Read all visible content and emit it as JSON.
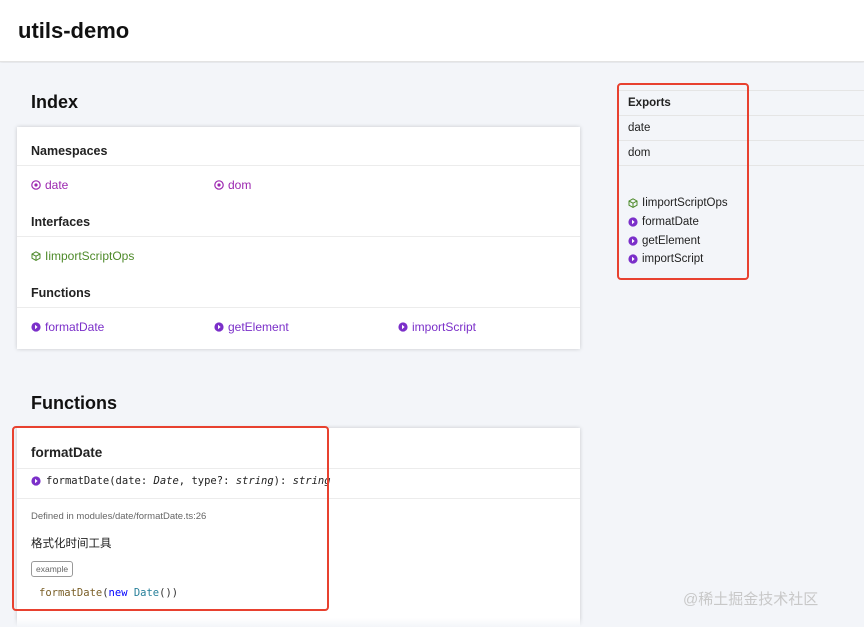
{
  "header": {
    "title": "utils-demo"
  },
  "index": {
    "heading": "Index",
    "namespaces": {
      "label": "Namespaces",
      "items": [
        "date",
        "dom"
      ]
    },
    "interfaces": {
      "label": "Interfaces",
      "items": [
        "IimportScriptOps"
      ]
    },
    "functions": {
      "label": "Functions",
      "items": [
        "formatDate",
        "getElement",
        "importScript"
      ]
    }
  },
  "functions_section": {
    "heading": "Functions",
    "entry": {
      "name": "formatDate",
      "signature": {
        "name": "formatDate",
        "open": "(",
        "p1": "date",
        "colon1": ": ",
        "t1": "Date",
        "comma": ", ",
        "p2": "type",
        "opt": "?",
        "colon2": ": ",
        "t2": "string",
        "close": "): ",
        "ret": "string"
      },
      "defined_in": "Defined in modules/date/formatDate.ts:26",
      "description": "格式化时间工具",
      "tag": "example",
      "example": {
        "fn": "formatDate",
        "open": "(",
        "kw": "new",
        "cls": "Date",
        "close": "())"
      }
    }
  },
  "exports": {
    "heading": "Exports",
    "modules": [
      "date",
      "dom"
    ],
    "interface": "IimportScriptOps",
    "functions": [
      "formatDate",
      "getElement",
      "importScript"
    ]
  },
  "watermark": "@稀土掘金技术社区",
  "colors": {
    "namespace": "#9c27b0",
    "interface": "#4e8a2a",
    "function": "#7b2fc9",
    "highlight": "#e8412f"
  },
  "icons": {
    "namespace": "namespace-icon",
    "interface": "interface-icon",
    "function": "function-icon"
  }
}
